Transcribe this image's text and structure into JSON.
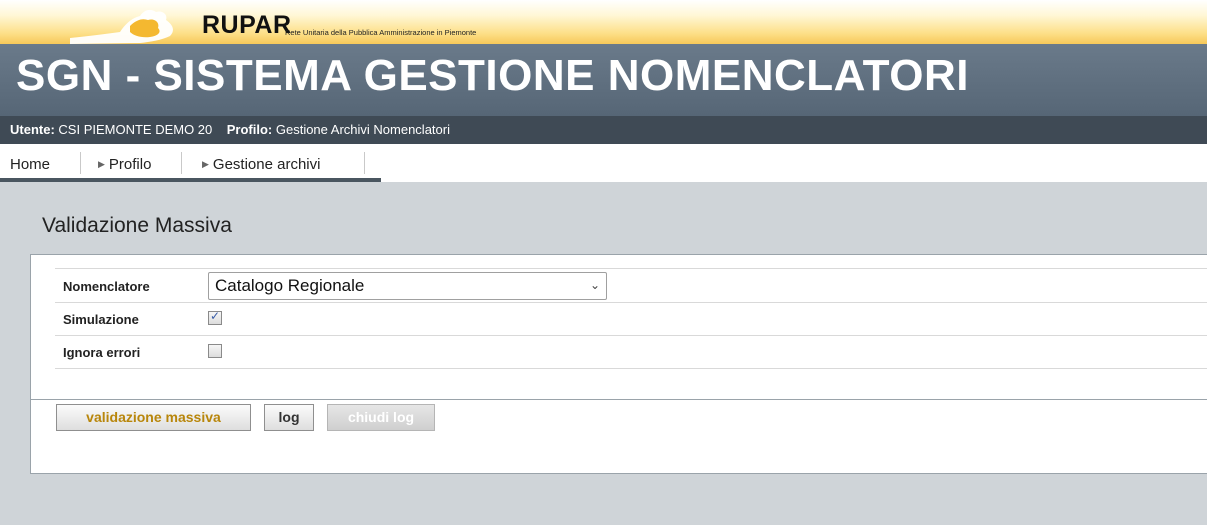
{
  "header": {
    "logo_text": "RUPAR",
    "logo_subtitle": "Rete Unitaria della Pubblica Amministrazione in Piemonte",
    "app_title": "SGN - SISTEMA GESTIONE NOMENCLATORI"
  },
  "userbar": {
    "user_label": "Utente:",
    "user_value": "CSI PIEMONTE DEMO 20",
    "profile_label": "Profilo:",
    "profile_value": "Gestione Archivi Nomenclatori"
  },
  "nav": {
    "home": "Home",
    "profilo": "Profilo",
    "gestione": "Gestione archivi"
  },
  "page": {
    "title": "Validazione Massiva"
  },
  "form": {
    "nomenclatore_label": "Nomenclatore",
    "nomenclatore_value": "Catalogo Regionale",
    "simulazione_label": "Simulazione",
    "simulazione_checked": true,
    "ignora_label": "Ignora errori",
    "ignora_checked": false
  },
  "buttons": {
    "validazione": "validazione massiva",
    "log": "log",
    "chiudi_log": "chiudi log"
  },
  "colors": {
    "title_band": "#5f6f7f",
    "user_bar": "#3f4a55",
    "content_bg": "#cfd4d8",
    "primary_button_text": "#b8860b"
  }
}
